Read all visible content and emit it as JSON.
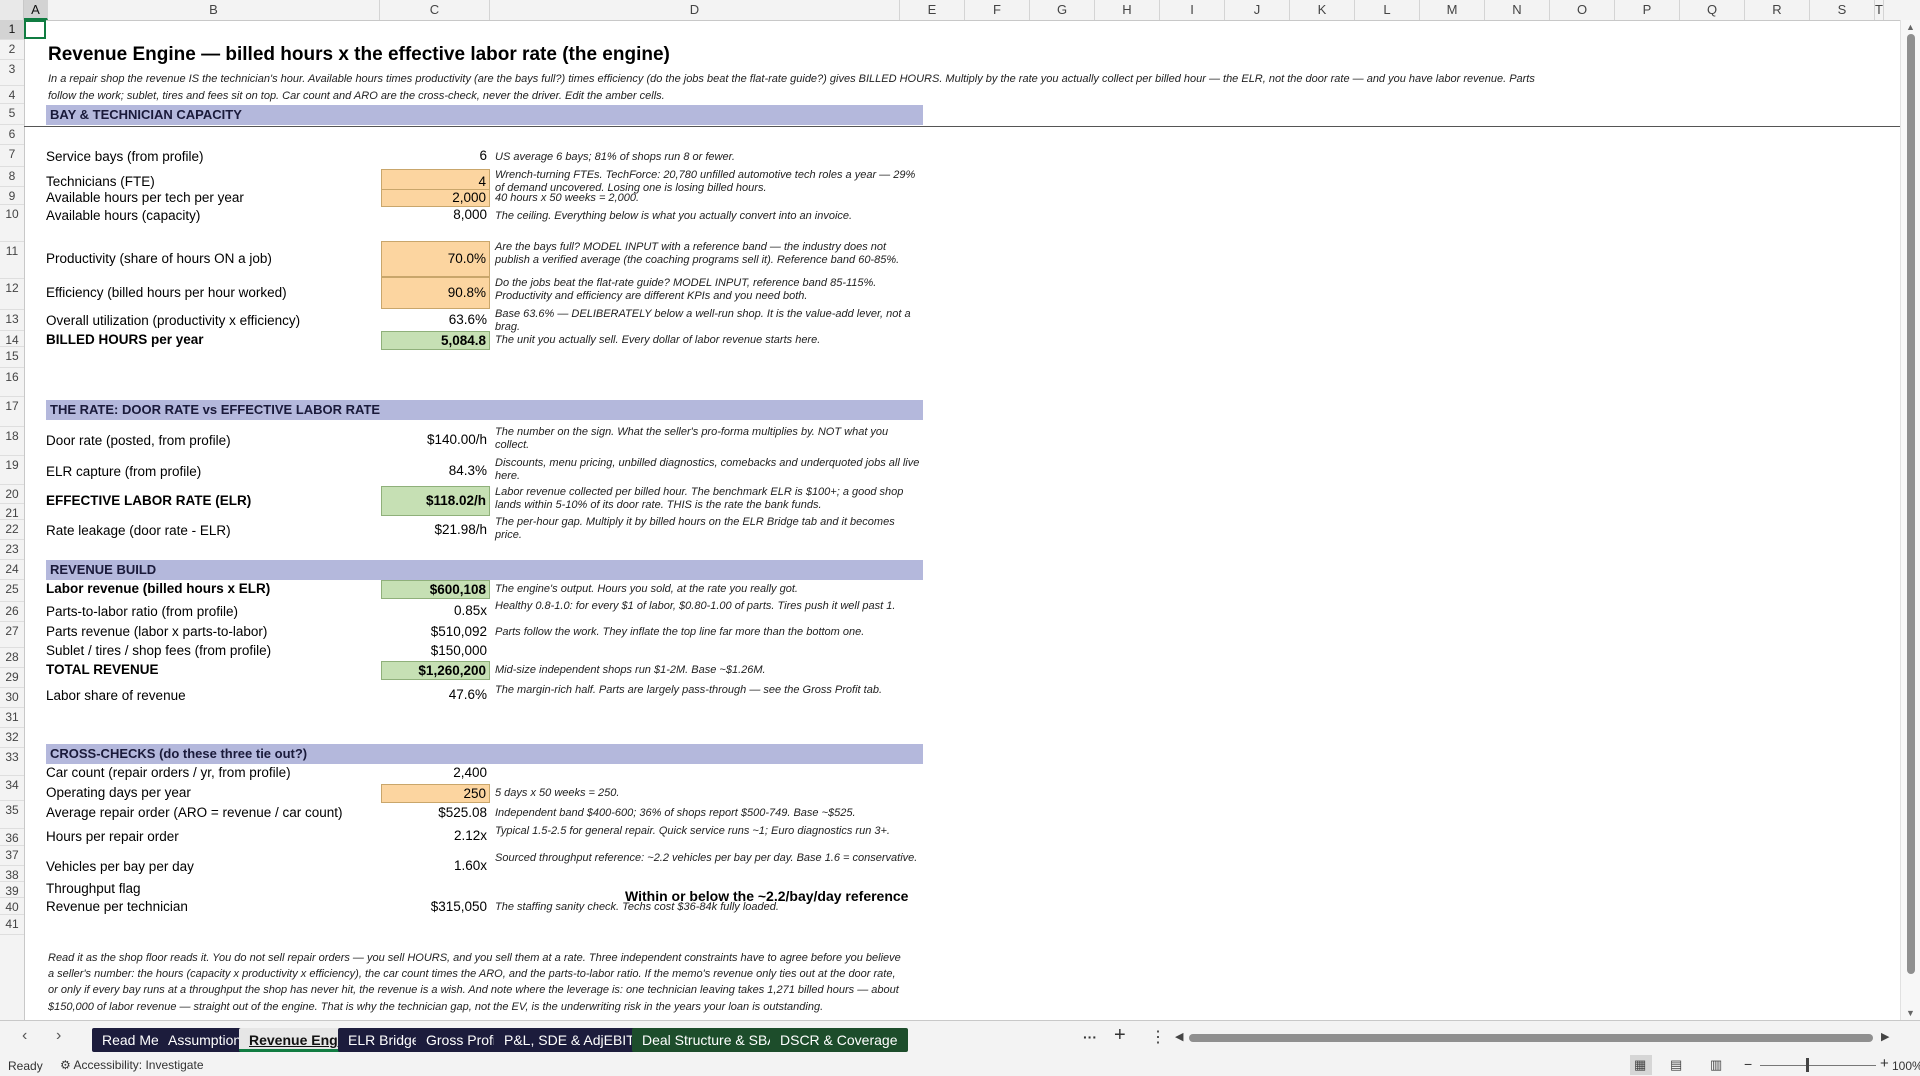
{
  "columns": [
    "A",
    "B",
    "C",
    "D",
    "E",
    "F",
    "G",
    "H",
    "I",
    "J",
    "K",
    "L",
    "M",
    "N",
    "O",
    "P",
    "Q",
    "R",
    "S",
    "T"
  ],
  "rows": [
    "1",
    "2",
    "3",
    "4",
    "5",
    "6",
    "7",
    "8",
    "9",
    "10",
    "11",
    "12",
    "13",
    "14",
    "15",
    "16",
    "17",
    "18",
    "19",
    "20",
    "21",
    "22",
    "23",
    "24",
    "25",
    "26",
    "27",
    "28",
    "29",
    "30",
    "31",
    "32",
    "33",
    "34",
    "35",
    "36",
    "37",
    "38",
    "39",
    "40",
    "41"
  ],
  "title": "Revenue Engine — billed hours x the effective labor rate (the engine)",
  "intro": "In a repair shop the revenue IS the technician's hour. Available hours times productivity (are the bays full?) times efficiency (do the jobs beat the flat-rate guide?) gives BILLED HOURS. Multiply by the rate you actually collect per billed hour — the ELR, not the door rate — and you have labor revenue. Parts follow the work; sublet, tires and fees sit on top. Car count and ARO are the cross-check, never the driver. Edit the amber cells.",
  "sections": {
    "bay": "BAY & TECHNICIAN CAPACITY",
    "rate": "THE RATE: DOOR RATE vs EFFECTIVE LABOR RATE",
    "revenue": "REVENUE BUILD",
    "cross": "CROSS-CHECKS  (do these three tie out?)"
  },
  "items": [
    {
      "label": "Service bays (from profile)",
      "value": "6",
      "note": "US average 6 bays; 81% of shops run 8 or fewer."
    },
    {
      "label": "Technicians (FTE)",
      "value": "4",
      "note": "Wrench-turning FTEs. TechForce: 20,780 unfilled automotive tech roles a year — 29% of demand uncovered. Losing one is losing billed hours."
    },
    {
      "label": "Available hours per tech per year",
      "value": "2,000",
      "note": "40 hours x 50 weeks = 2,000."
    },
    {
      "label": "Available hours (capacity)",
      "value": "8,000",
      "note": "The ceiling. Everything below is what you actually convert into an invoice."
    },
    {
      "label": "Productivity (share of hours ON a job)",
      "value": "70.0%",
      "note": "Are the bays full? MODEL INPUT with a reference band — the industry does not publish a verified average (the coaching programs sell it). Reference band 60-85%."
    },
    {
      "label": "Efficiency (billed hours per hour worked)",
      "value": "90.8%",
      "note": "Do the jobs beat the flat-rate guide? MODEL INPUT, reference band 85-115%. Productivity and efficiency are different KPIs and you need both."
    },
    {
      "label": "Overall utilization (productivity x efficiency)",
      "value": "63.6%",
      "note": "Base 63.6% — DELIBERATELY below a well-run shop. It is the value-add lever, not a brag."
    },
    {
      "label": "BILLED HOURS per year",
      "value": "5,084.8",
      "note": "The unit you actually sell. Every dollar of labor revenue starts here."
    },
    {
      "label": "Door rate (posted, from profile)",
      "value": "$140.00/h",
      "note": "The number on the sign. What the seller's pro-forma multiplies by. NOT what you collect."
    },
    {
      "label": "ELR capture (from profile)",
      "value": "84.3%",
      "note": "Discounts, menu pricing, unbilled diagnostics, comebacks and underquoted jobs all live here."
    },
    {
      "label": "EFFECTIVE LABOR RATE (ELR)",
      "value": "$118.02/h",
      "note": "Labor revenue collected per billed hour. The benchmark ELR is $100+; a good shop lands within 5-10% of its door rate. THIS is the rate the bank funds."
    },
    {
      "label": "Rate leakage (door rate - ELR)",
      "value": "$21.98/h",
      "note": "The per-hour gap. Multiply it by billed hours on the ELR Bridge tab and it becomes price."
    },
    {
      "label": "Labor revenue (billed hours x ELR)",
      "value": "$600,108",
      "note": "The engine's output. Hours you sold, at the rate you really got."
    },
    {
      "label": "Parts-to-labor ratio (from profile)",
      "value": "0.85x",
      "note": "Healthy 0.8-1.0: for every $1 of labor, $0.80-1.00 of parts. Tires push it well past 1."
    },
    {
      "label": "Parts revenue (labor x parts-to-labor)",
      "value": "$510,092",
      "note": "Parts follow the work. They inflate the top line far more than the bottom one."
    },
    {
      "label": "Sublet / tires / shop fees (from profile)",
      "value": "$150,000",
      "note": ""
    },
    {
      "label": "TOTAL REVENUE",
      "value": "$1,260,200",
      "note": "Mid-size independent shops run $1-2M. Base ~$1.26M."
    },
    {
      "label": "Labor share of revenue",
      "value": "47.6%",
      "note": "The margin-rich half. Parts are largely pass-through — see the Gross Profit tab."
    },
    {
      "label": "Car count (repair orders / yr, from profile)",
      "value": "2,400",
      "note": ""
    },
    {
      "label": "Operating days per year",
      "value": "250",
      "note": "5 days x 50 weeks = 250."
    },
    {
      "label": "Average repair order (ARO = revenue / car count)",
      "value": "$525.08",
      "note": "Independent band $400-600; 36% of shops report $500-749. Base ~$525."
    },
    {
      "label": "Hours per repair order",
      "value": "2.12x",
      "note": "Typical 1.5-2.5 for general repair. Quick service runs ~1; Euro diagnostics run 3+."
    },
    {
      "label": "Vehicles per bay per day",
      "value": "1.60x",
      "note": "Sourced throughput reference: ~2.2 vehicles per bay per day. Base 1.6 = conservative."
    },
    {
      "label": "Throughput flag",
      "value": "",
      "note": ""
    },
    {
      "label": "Revenue per technician",
      "value": "$315,050",
      "note": "The staffing sanity check. Techs cost $36-84k fully loaded."
    }
  ],
  "throughput_flag": "Within or below the ~2.2/bay/day reference",
  "closing": "Read it as the shop floor reads it. You do not sell repair orders — you sell HOURS, and you sell them at a rate. Three independent constraints have to agree before you believe a seller's number: the hours (capacity x productivity x efficiency), the car count times the ARO, and the parts-to-labor ratio. If the memo's revenue only ties out at the door rate, or only if every bay runs at a throughput the shop has never hit, the revenue is a wish. And note where the leverage is: one technician leaving takes 1,271 billed hours — about $150,000 of labor revenue — straight out of the engine. That is why the technician gap, not the EV, is the underwriting risk in the years your loan is outstanding.",
  "tabs": [
    "Read Me",
    "Assumptions",
    "Revenue Engine",
    "ELR Bridge",
    "Gross Profit",
    "P&L, SDE & AdjEBITDA",
    "Deal Structure & SBA",
    "DSCR & Coverage"
  ],
  "active_tab": "Revenue Engine",
  "tab_controls": {
    "more": "···",
    "add": "+",
    "options": "⋮"
  },
  "status": {
    "ready": "Ready",
    "accessibility": "Accessibility: Investigate",
    "zoom": "100%"
  }
}
